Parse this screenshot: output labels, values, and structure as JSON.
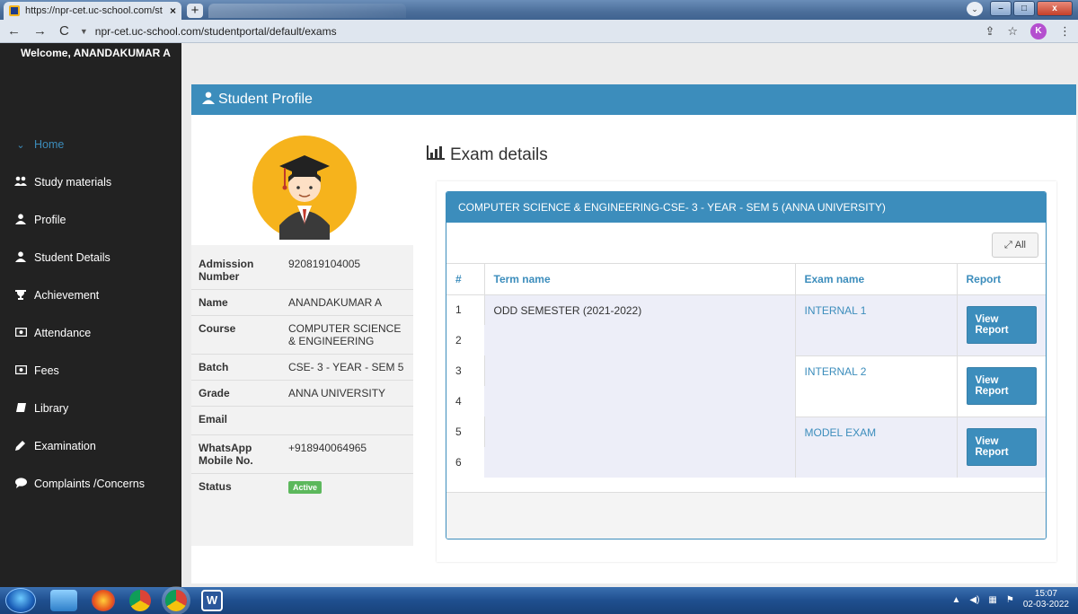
{
  "browser": {
    "tab_title": "https://npr-cet.uc-school.com/st",
    "tab_close": "×",
    "new_tab": "+",
    "url": "npr-cet.uc-school.com/studentportal/default/exams",
    "profile_letter": "K"
  },
  "sidebar": {
    "welcome": "Welcome, ANANDAKUMAR A",
    "items": [
      {
        "label": "Home",
        "icon": "chevron-down-icon"
      },
      {
        "label": "Study materials",
        "icon": "users-icon"
      },
      {
        "label": "Profile",
        "icon": "user-icon"
      },
      {
        "label": "Student Details",
        "icon": "user-icon"
      },
      {
        "label": "Achievement",
        "icon": "trophy-icon"
      },
      {
        "label": "Attendance",
        "icon": "money-icon"
      },
      {
        "label": "Fees",
        "icon": "money-icon"
      },
      {
        "label": "Library",
        "icon": "book-icon"
      },
      {
        "label": "Examination",
        "icon": "pencil-icon"
      },
      {
        "label": "Complaints /Concerns",
        "icon": "comment-icon"
      }
    ]
  },
  "profile": {
    "header": "Student Profile",
    "fields": [
      {
        "key": "Admission Number",
        "value": "920819104005"
      },
      {
        "key": "Name",
        "value": "ANANDAKUMAR A"
      },
      {
        "key": "Course",
        "value": "COMPUTER SCIENCE & ENGINEERING"
      },
      {
        "key": "Batch",
        "value": "CSE- 3 - YEAR - SEM 5"
      },
      {
        "key": "Grade",
        "value": "ANNA UNIVERSITY"
      },
      {
        "key": "Email",
        "value": ""
      },
      {
        "key": "WhatsApp Mobile No.",
        "value": "+918940064965"
      }
    ],
    "status_label": "Status",
    "status_value": "Active"
  },
  "exams": {
    "title": "Exam details",
    "box_header": "COMPUTER SCIENCE & ENGINEERING-CSE- 3 - YEAR - SEM 5 (ANNA UNIVERSITY)",
    "all_button": "All",
    "columns": [
      "#",
      "Term name",
      "Exam name",
      "Report"
    ],
    "row_numbers": [
      "1",
      "2",
      "3",
      "4",
      "5",
      "6"
    ],
    "term_name": "ODD SEMESTER (2021-2022)",
    "exam_names": [
      "INTERNAL 1",
      "INTERNAL 2",
      "MODEL EXAM"
    ],
    "report_button": "View Report"
  },
  "taskbar": {
    "time": "15:07",
    "date": "02-03-2022"
  },
  "colors": {
    "primary": "#3c8dbc",
    "sidebar_bg": "#222222",
    "success": "#5cb85c"
  }
}
